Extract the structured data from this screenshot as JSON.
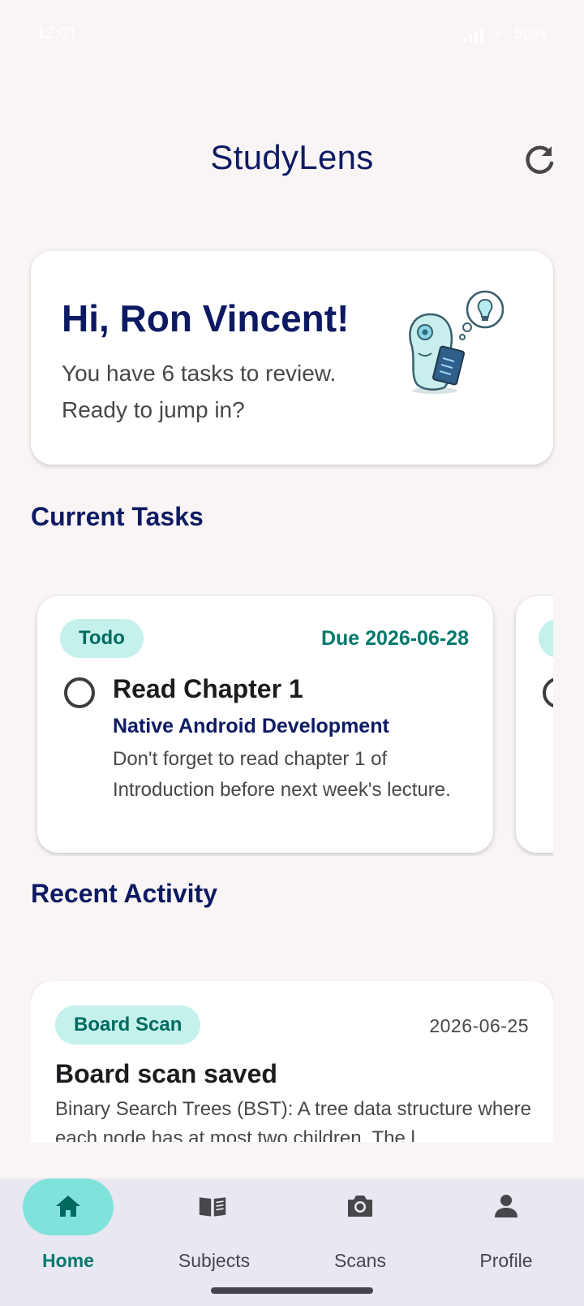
{
  "status_bar": {
    "time": "12:01",
    "battery": "50%"
  },
  "app_bar": {
    "title": "StudyLens",
    "refresh_icon": "refresh-icon"
  },
  "greeting": {
    "title": "Hi, Ron Vincent!",
    "subtitle": "You have 6 tasks to review. Ready to jump in?",
    "mascot_icon": "mascot-reading-icon"
  },
  "current_tasks": {
    "section_title": "Current Tasks",
    "tasks": [
      {
        "status": "Todo",
        "due": "Due 2026-06-28",
        "title": "Read Chapter 1",
        "subject": "Native Android Development",
        "description": "Don't forget to read chapter 1 of Introduction before next week's lecture."
      }
    ]
  },
  "recent_activity": {
    "section_title": "Recent Activity",
    "items": [
      {
        "type": "Board Scan",
        "date": "2026-06-25",
        "title": "Board scan saved",
        "description": "Binary Search Trees (BST): A tree data structure where each node has at most two children. The l"
      }
    ]
  },
  "bottom_nav": {
    "items": [
      {
        "label": "Home",
        "icon": "home-icon",
        "active": true
      },
      {
        "label": "Subjects",
        "icon": "book-icon",
        "active": false
      },
      {
        "label": "Scans",
        "icon": "camera-icon",
        "active": false
      },
      {
        "label": "Profile",
        "icon": "person-icon",
        "active": false
      }
    ]
  },
  "colors": {
    "primary": "#0d1a63",
    "teal_accent": "#00796b",
    "chip_bg": "#c4f1ec",
    "nav_active_pill": "#7fe3dc",
    "background": "#f9f5f4"
  }
}
